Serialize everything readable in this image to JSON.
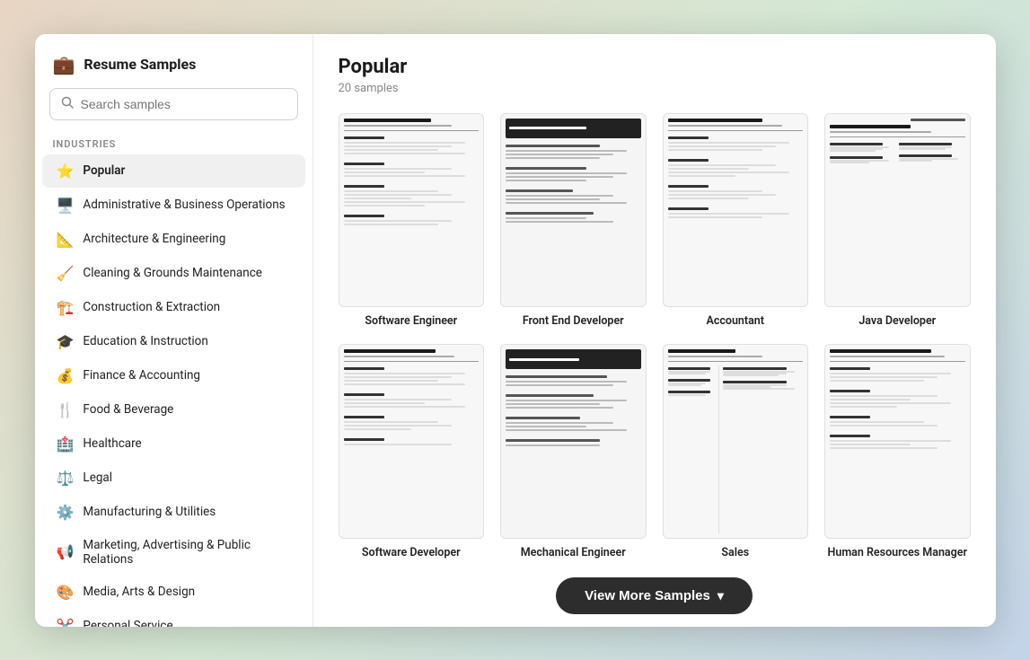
{
  "modal": {
    "title": "Resume Samples",
    "search": {
      "placeholder": "Search samples"
    },
    "industries_label": "Industries",
    "sidebar_items": [
      {
        "id": "popular",
        "label": "Popular",
        "icon": "⭐",
        "active": true
      },
      {
        "id": "admin-business",
        "label": "Administrative & Business Operations",
        "icon": "🖥️",
        "active": false
      },
      {
        "id": "architecture",
        "label": "Architecture & Engineering",
        "icon": "📐",
        "active": false
      },
      {
        "id": "cleaning",
        "label": "Cleaning & Grounds Maintenance",
        "icon": "🧹",
        "active": false
      },
      {
        "id": "construction",
        "label": "Construction & Extraction",
        "icon": "🏗️",
        "active": false
      },
      {
        "id": "education",
        "label": "Education & Instruction",
        "icon": "🎓",
        "active": false
      },
      {
        "id": "finance",
        "label": "Finance & Accounting",
        "icon": "💰",
        "active": false
      },
      {
        "id": "food",
        "label": "Food & Beverage",
        "icon": "🍴",
        "active": false
      },
      {
        "id": "healthcare",
        "label": "Healthcare",
        "icon": "🏥",
        "active": false
      },
      {
        "id": "legal",
        "label": "Legal",
        "icon": "⚖️",
        "active": false
      },
      {
        "id": "manufacturing",
        "label": "Manufacturing & Utilities",
        "icon": "⚙️",
        "active": false
      },
      {
        "id": "marketing",
        "label": "Marketing, Advertising & Public Relations",
        "icon": "📢",
        "active": false
      },
      {
        "id": "media",
        "label": "Media, Arts & Design",
        "icon": "🎨",
        "active": false
      },
      {
        "id": "personal",
        "label": "Personal Service",
        "icon": "✂️",
        "active": false
      }
    ],
    "main": {
      "section_title": "Popular",
      "section_subtitle": "20 samples",
      "cards": [
        {
          "id": "software-engineer",
          "label": "Software Engineer"
        },
        {
          "id": "front-end-developer",
          "label": "Front End Developer"
        },
        {
          "id": "accountant",
          "label": "Accountant"
        },
        {
          "id": "java-developer",
          "label": "Java Developer"
        },
        {
          "id": "software-developer",
          "label": "Software Developer"
        },
        {
          "id": "mechanical-engineer",
          "label": "Mechanical Engineer"
        },
        {
          "id": "sales",
          "label": "Sales"
        },
        {
          "id": "hr-manager",
          "label": "Human Resources Manager"
        }
      ],
      "view_more_btn": "View More Samples"
    }
  }
}
